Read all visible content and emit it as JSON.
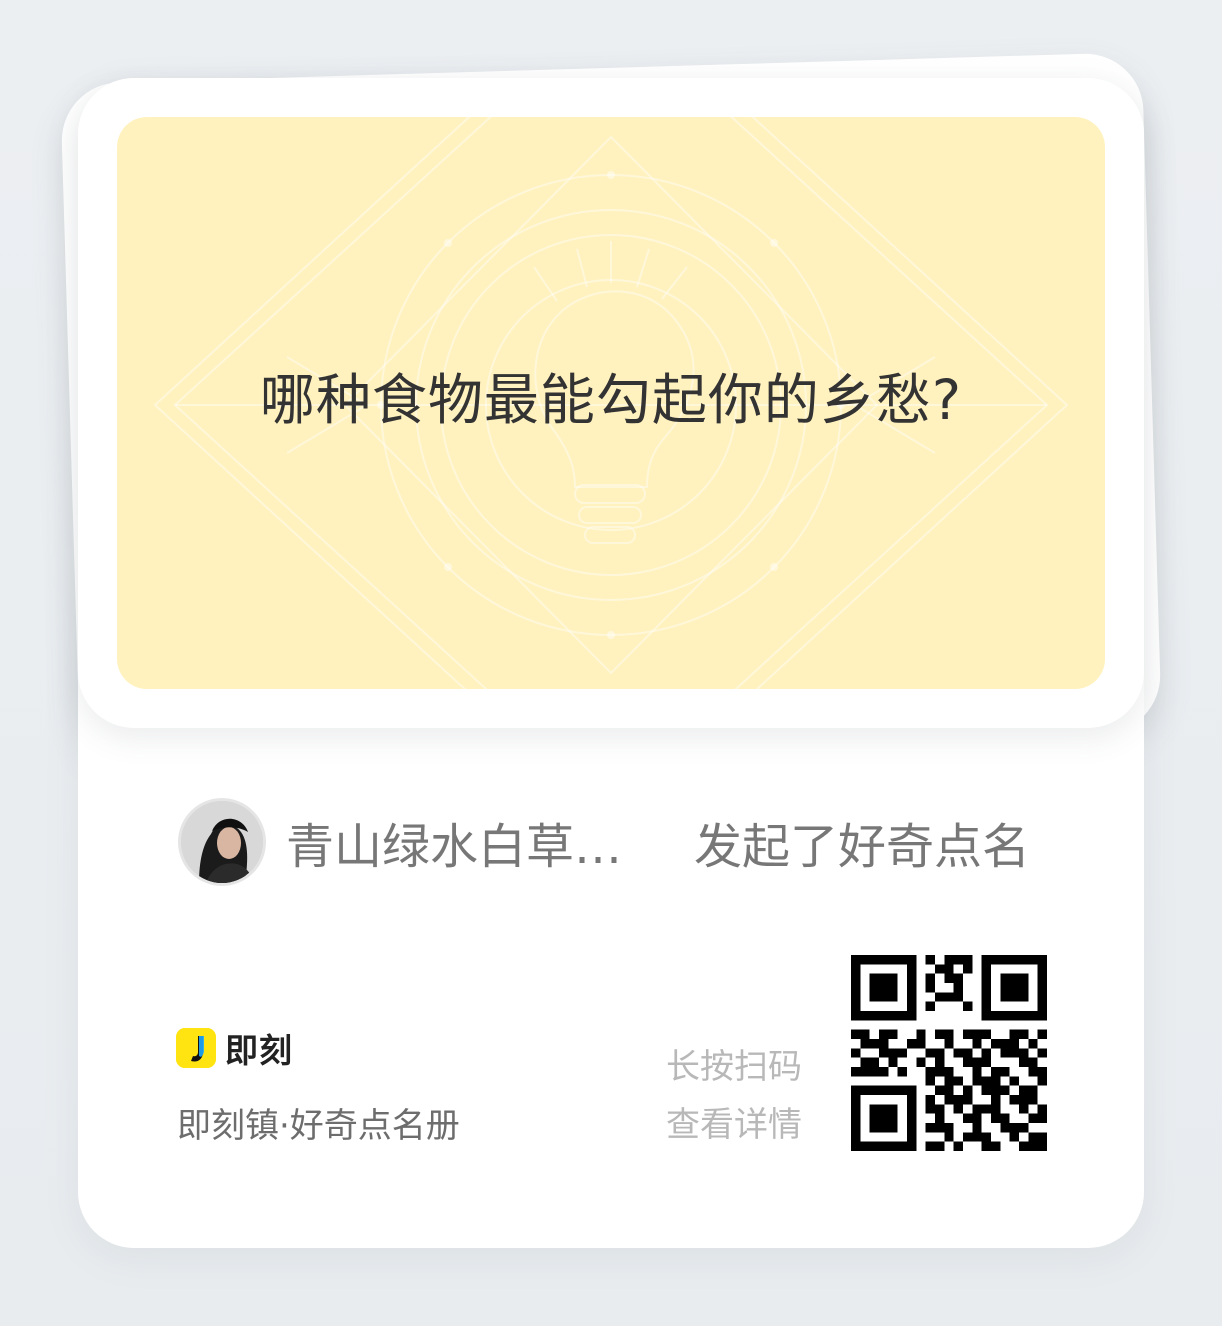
{
  "card": {
    "question": "哪种食物最能勾起你的乡愁?"
  },
  "initiator": {
    "name": "青山绿水白草…",
    "action": "发起了好奇点名"
  },
  "brand": {
    "logo_text": "即刻",
    "subtitle": "即刻镇·好奇点名册"
  },
  "qr": {
    "hint_line1": "长按扫码",
    "hint_line2": "查看详情"
  },
  "colors": {
    "question_background": "#fff2bf",
    "logo_yellow": "#ffe411"
  },
  "icons": {
    "logo": "jike-logo-icon",
    "decoration": "lightbulb-pattern-icon",
    "qr": "qr-code-icon"
  }
}
